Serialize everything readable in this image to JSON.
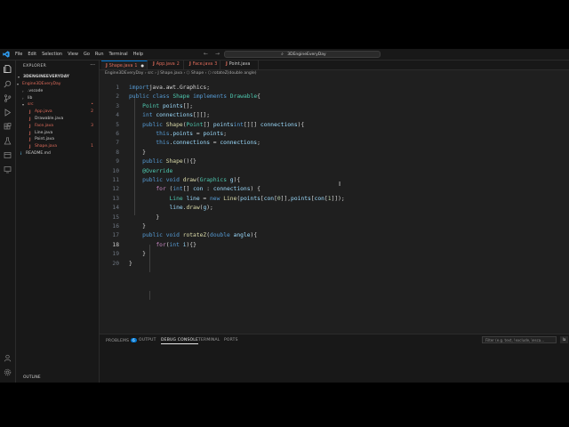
{
  "menu": [
    "File",
    "Edit",
    "Selection",
    "View",
    "Go",
    "Run",
    "Terminal",
    "Help"
  ],
  "nav_arrows": [
    "←",
    "→"
  ],
  "search": {
    "text": "3DEngineEveryDay"
  },
  "sidebar": {
    "title": "EXPLORER",
    "more": "···",
    "project": "3DENGINEEVERYDAY",
    "tree": [
      {
        "label": "Engine3DEveryDay",
        "indent": 1,
        "chevron": "▾",
        "color": "#e06c5b",
        "badge": "",
        "icon": ""
      },
      {
        "label": ".vscode",
        "indent": 2,
        "chevron": "›",
        "color": "#cccccc",
        "badge": "",
        "icon": ""
      },
      {
        "label": "lib",
        "indent": 2,
        "chevron": "›",
        "color": "#cccccc",
        "badge": "",
        "icon": ""
      },
      {
        "label": "src",
        "indent": 2,
        "chevron": "▾",
        "color": "#e06c5b",
        "badge": "•",
        "icon": ""
      },
      {
        "label": "App.java",
        "indent": 3,
        "chevron": "",
        "color": "#e06c5b",
        "badge": "2",
        "icon": "J"
      },
      {
        "label": "Drawable.java",
        "indent": 3,
        "chevron": "",
        "color": "#cccccc",
        "badge": "",
        "icon": "J"
      },
      {
        "label": "Face.java",
        "indent": 3,
        "chevron": "",
        "color": "#e06c5b",
        "badge": "3",
        "icon": "J"
      },
      {
        "label": "Line.java",
        "indent": 3,
        "chevron": "",
        "color": "#cccccc",
        "badge": "",
        "icon": "J"
      },
      {
        "label": "Point.java",
        "indent": 3,
        "chevron": "",
        "color": "#cccccc",
        "badge": "",
        "icon": "J"
      },
      {
        "label": "Shape.java",
        "indent": 3,
        "chevron": "",
        "color": "#e06c5b",
        "badge": "1",
        "icon": "J"
      },
      {
        "label": "README.md",
        "indent": 1,
        "chevron": "",
        "color": "#cccccc",
        "badge": "",
        "icon": "i"
      }
    ],
    "outline": "OUTLINE"
  },
  "tabs": [
    {
      "label": "Shape.java",
      "suffix": "1",
      "modified": "●",
      "active": true,
      "color": "#e06c5b"
    },
    {
      "label": "App.java",
      "suffix": "2",
      "modified": "",
      "active": false,
      "color": "#e06c5b"
    },
    {
      "label": "Face.java",
      "suffix": "3",
      "modified": "",
      "active": false,
      "color": "#e06c5b"
    },
    {
      "label": "Point.java",
      "suffix": "",
      "modified": "",
      "active": false,
      "color": "#cccccc"
    }
  ],
  "breadcrumb": "Engine3DEveryDay › src › J Shape.java › ⬡ Shape › ⬡ rotateZ(double angle)",
  "code": {
    "current_line": 18,
    "lines": [
      [
        [
          "kw",
          "import"
        ],
        [
          "",
          "java.awt.Graphics;"
        ]
      ],
      [
        [
          "kw",
          "public"
        ],
        [
          "",
          " "
        ],
        [
          "kw",
          "class"
        ],
        [
          "",
          " "
        ],
        [
          "ty",
          "Shape"
        ],
        [
          "",
          " "
        ],
        [
          "kw",
          "implements"
        ],
        [
          "",
          " "
        ],
        [
          "ty",
          "Drawable"
        ],
        [
          "",
          "{"
        ]
      ],
      [
        [
          "",
          "    "
        ],
        [
          "ty",
          "Point"
        ],
        [
          "",
          " "
        ],
        [
          "vr",
          "points"
        ],
        [
          "",
          "[];"
        ]
      ],
      [
        [
          "",
          "    "
        ],
        [
          "kw",
          "int"
        ],
        [
          "",
          " "
        ],
        [
          "vr",
          "connections"
        ],
        [
          "",
          "[][];"
        ]
      ],
      [
        [
          "",
          "    "
        ],
        [
          "kw",
          "public"
        ],
        [
          "",
          " "
        ],
        [
          "fn",
          "Shape"
        ],
        [
          "",
          "("
        ],
        [
          "ty",
          "Point"
        ],
        [
          "",
          "[] "
        ],
        [
          "vr",
          "points"
        ],
        [
          ",  "
        ],
        [
          "kw",
          "int"
        ],
        [
          "",
          "[][] "
        ],
        [
          "vr",
          "connections"
        ],
        [
          "",
          "){"
        ]
      ],
      [
        [
          "",
          "        "
        ],
        [
          "kw",
          "this"
        ],
        [
          "",
          "."
        ],
        [
          "vr",
          "points"
        ],
        [
          "",
          " = "
        ],
        [
          "vr",
          "points"
        ],
        [
          "",
          ";"
        ]
      ],
      [
        [
          "",
          "        "
        ],
        [
          "kw",
          "this"
        ],
        [
          "",
          "."
        ],
        [
          "vr",
          "connections"
        ],
        [
          "",
          " = "
        ],
        [
          "vr",
          "connections"
        ],
        [
          "",
          ";"
        ]
      ],
      [
        [
          "",
          "    }"
        ]
      ],
      [
        [
          "",
          "    "
        ],
        [
          "kw",
          "public"
        ],
        [
          "",
          " "
        ],
        [
          "fn",
          "Shape"
        ],
        [
          "",
          "(){}"
        ]
      ],
      [
        [
          "",
          "    "
        ],
        [
          "ty",
          "@Override"
        ]
      ],
      [
        [
          "",
          "    "
        ],
        [
          "kw",
          "public"
        ],
        [
          "",
          " "
        ],
        [
          "kw",
          "void"
        ],
        [
          "",
          " "
        ],
        [
          "fn",
          "draw"
        ],
        [
          "",
          "("
        ],
        [
          "ty",
          "Graphics"
        ],
        [
          "",
          " "
        ],
        [
          "vr",
          "g"
        ],
        [
          "",
          "){"
        ]
      ],
      [
        [
          "",
          "        "
        ],
        [
          "ctl",
          "for"
        ],
        [
          "",
          " ("
        ],
        [
          "kw",
          "int"
        ],
        [
          "",
          "[] "
        ],
        [
          "vr",
          "con"
        ],
        [
          "",
          " : "
        ],
        [
          "vr",
          "connections"
        ],
        [
          "",
          ") {"
        ]
      ],
      [
        [
          "",
          "            "
        ],
        [
          "ty",
          "Line"
        ],
        [
          "",
          " "
        ],
        [
          "vr",
          "line"
        ],
        [
          "",
          " = "
        ],
        [
          "kw",
          "new"
        ],
        [
          "",
          " "
        ],
        [
          "fn",
          "Line"
        ],
        [
          "",
          "("
        ],
        [
          "vr",
          "points"
        ],
        [
          "",
          "["
        ],
        [
          "vr",
          "con"
        ],
        [
          "",
          "["
        ],
        [
          "num",
          "0"
        ],
        [
          "",
          "]],"
        ],
        [
          "vr",
          "points"
        ],
        [
          "",
          "["
        ],
        [
          "vr",
          "con"
        ],
        [
          "",
          "["
        ],
        [
          "num",
          "1"
        ],
        [
          "",
          "]]);"
        ]
      ],
      [
        [
          "",
          "            "
        ],
        [
          "vr",
          "line"
        ],
        [
          "",
          "."
        ],
        [
          "fn",
          "draw"
        ],
        [
          "",
          "("
        ],
        [
          "vr",
          "g"
        ],
        [
          "",
          ");"
        ]
      ],
      [
        [
          "",
          "        }"
        ]
      ],
      [
        [
          "",
          "    }"
        ]
      ],
      [
        [
          "",
          "    "
        ],
        [
          "kw",
          "public"
        ],
        [
          "",
          " "
        ],
        [
          "kw",
          "void"
        ],
        [
          "",
          " "
        ],
        [
          "fn",
          "rotateZ"
        ],
        [
          "",
          "("
        ],
        [
          "kw",
          "double"
        ],
        [
          "",
          " "
        ],
        [
          "vr",
          "angle"
        ],
        [
          "",
          "){"
        ]
      ],
      [
        [
          "",
          "        "
        ],
        [
          "ctl",
          "for"
        ],
        [
          "",
          "("
        ],
        [
          "kw",
          "int"
        ],
        [
          "",
          " "
        ],
        [
          "vr",
          "i"
        ],
        [
          "",
          "){}"
        ]
      ],
      [
        [
          "",
          "    }"
        ]
      ],
      [
        [
          "",
          "}"
        ]
      ]
    ]
  },
  "panel": {
    "tabs": [
      {
        "label": "PROBLEMS",
        "badge": "6",
        "active": false
      },
      {
        "label": "OUTPUT",
        "badge": "",
        "active": false
      },
      {
        "label": "DEBUG CONSOLE",
        "badge": "",
        "active": true
      },
      {
        "label": "TERMINAL",
        "badge": "",
        "active": false
      },
      {
        "label": "PORTS",
        "badge": "",
        "active": false
      }
    ],
    "filter_placeholder": "Filter (e.g. text, !exclude, \\esca...",
    "button": "la"
  }
}
